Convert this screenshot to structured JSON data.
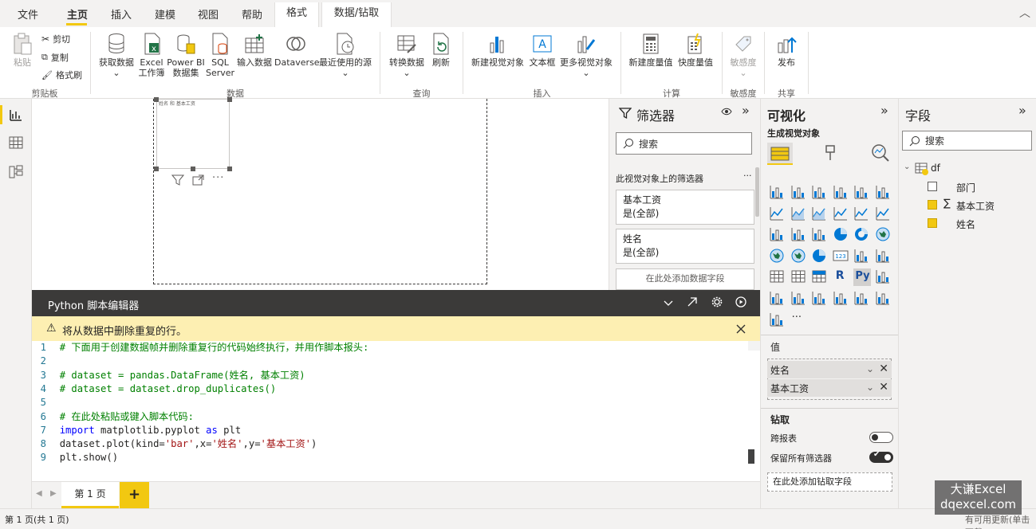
{
  "menu": {
    "items": [
      "文件",
      "主页",
      "插入",
      "建模",
      "视图",
      "帮助"
    ],
    "context_tabs": [
      "格式",
      "数据/钻取"
    ]
  },
  "ribbon": {
    "clipboard": {
      "paste": "粘贴",
      "cut": "剪切",
      "copy": "复制",
      "format_painter": "格式刷",
      "group": "剪贴板"
    },
    "data": {
      "get_data": "获取数据",
      "excel_line1": "Excel",
      "excel_line2": "工作簿",
      "pbi_line1": "Power BI",
      "pbi_line2": "数据集",
      "sql_line1": "SQL",
      "sql_line2": "Server",
      "enter_data": "输入数据",
      "dataverse": "Dataverse",
      "recent": "最近使用的源",
      "group": "数据"
    },
    "query": {
      "transform": "转换数据",
      "refresh": "刷新",
      "group": "查询"
    },
    "insert": {
      "new_visual": "新建视觉对象",
      "textbox": "文本框",
      "more_visuals": "更多视觉对象",
      "group": "插入"
    },
    "calc": {
      "new_measure": "新建度量值",
      "quick_measure": "快度量值",
      "group": "计算"
    },
    "sensitivity": {
      "label": "敏感度",
      "group": "敏感度"
    },
    "share": {
      "publish": "发布",
      "group": "共享"
    }
  },
  "canvas": {
    "visual_title": "姓名 和 基本工资"
  },
  "python_editor": {
    "title": "Python 脚本编辑器",
    "warning": "将从数据中删除重复的行。",
    "lines": [
      {
        "n": "1",
        "parts": [
          {
            "t": "# 下面用于创建数据帧并删除重复行的代码始终执行，并用作脚本报头:",
            "c": "cm"
          }
        ]
      },
      {
        "n": "2",
        "parts": []
      },
      {
        "n": "3",
        "parts": [
          {
            "t": "# dataset = pandas.DataFrame(姓名, 基本工资)",
            "c": "cm"
          }
        ]
      },
      {
        "n": "4",
        "parts": [
          {
            "t": "# dataset = dataset.drop_duplicates()",
            "c": "cm"
          }
        ]
      },
      {
        "n": "5",
        "parts": []
      },
      {
        "n": "6",
        "parts": [
          {
            "t": "# 在此处粘贴或键入脚本代码:",
            "c": "cm"
          }
        ]
      },
      {
        "n": "7",
        "parts": [
          {
            "t": "import",
            "c": "kw"
          },
          {
            "t": " matplotlib.pyplot ",
            "c": ""
          },
          {
            "t": "as",
            "c": "kw"
          },
          {
            "t": " plt",
            "c": ""
          }
        ]
      },
      {
        "n": "8",
        "parts": [
          {
            "t": "dataset.plot(kind=",
            "c": ""
          },
          {
            "t": "'bar'",
            "c": "st"
          },
          {
            "t": ",x=",
            "c": ""
          },
          {
            "t": "'姓名'",
            "c": "st"
          },
          {
            "t": ",y=",
            "c": ""
          },
          {
            "t": "'基本工资'",
            "c": "st"
          },
          {
            "t": ")",
            "c": ""
          }
        ]
      },
      {
        "n": "9",
        "parts": [
          {
            "t": "plt.show()",
            "c": ""
          }
        ]
      }
    ]
  },
  "pages": {
    "tab": "第 1 页",
    "add": "+"
  },
  "status": {
    "left": "第 1 页(共 1 页)",
    "right": "有可用更新(单击下载)"
  },
  "filters": {
    "title": "筛选器",
    "search_placeholder": "搜索",
    "section": "此视觉对象上的筛选器",
    "cards": [
      {
        "name": "基本工资",
        "value": "是(全部)"
      },
      {
        "name": "姓名",
        "value": "是(全部)"
      }
    ],
    "add_field": "在此处添加数据字段"
  },
  "viz": {
    "title": "可视化",
    "subtitle": "生成视觉对象",
    "values_label": "值",
    "values": [
      "姓名",
      "基本工资"
    ],
    "drillthrough": "钻取",
    "cross_report": "跨报表",
    "keep_filters": "保留所有筛选器",
    "add_drill": "在此处添加钻取字段"
  },
  "fields": {
    "title": "字段",
    "search_placeholder": "搜索",
    "table": "df",
    "items": [
      {
        "name": "部门",
        "checked": false,
        "sigma": false
      },
      {
        "name": "基本工资",
        "checked": true,
        "sigma": true
      },
      {
        "name": "姓名",
        "checked": true,
        "sigma": false
      }
    ]
  },
  "watermark": {
    "line1": "大谦Excel",
    "line2": "dqexcel.com"
  },
  "colors": {
    "accent": "#f2c811",
    "dark_header": "#3b3a39",
    "warning_bg": "#fdefb2"
  }
}
